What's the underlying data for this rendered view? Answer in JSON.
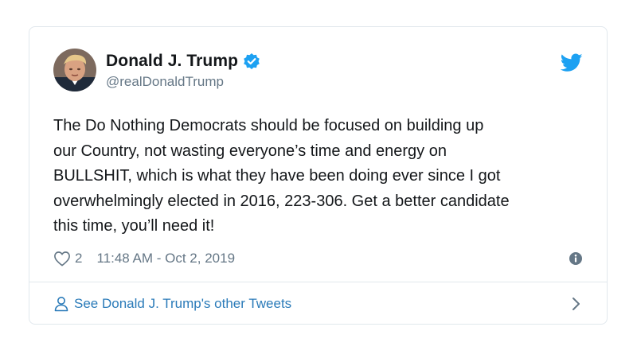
{
  "tweet": {
    "author": {
      "display_name": "Donald J. Trump",
      "handle": "@realDonaldTrump",
      "verified": true
    },
    "text": "The Do Nothing Democrats should be focused on building up\nour Country, not wasting everyone’s time and energy on\nBULLSHIT, which is what they have been doing ever since I got\noverwhelmingly elected in 2016, 223-306. Get a better candidate\nthis time, you’ll need it!",
    "likes": "2",
    "timestamp": "11:48 AM - Oct 2, 2019"
  },
  "footer": {
    "link_text": "See Donald J. Trump's other Tweets"
  },
  "icons": {
    "verified": "verified-badge-icon",
    "bird": "twitter-bird-icon",
    "heart": "heart-icon",
    "info": "info-icon",
    "person": "person-icon",
    "chevron": "chevron-right-icon"
  },
  "colors": {
    "brand_blue": "#1da1f2",
    "link_blue": "#2b7bb9",
    "muted_gray": "#657786",
    "border": "#e1e8ed"
  }
}
